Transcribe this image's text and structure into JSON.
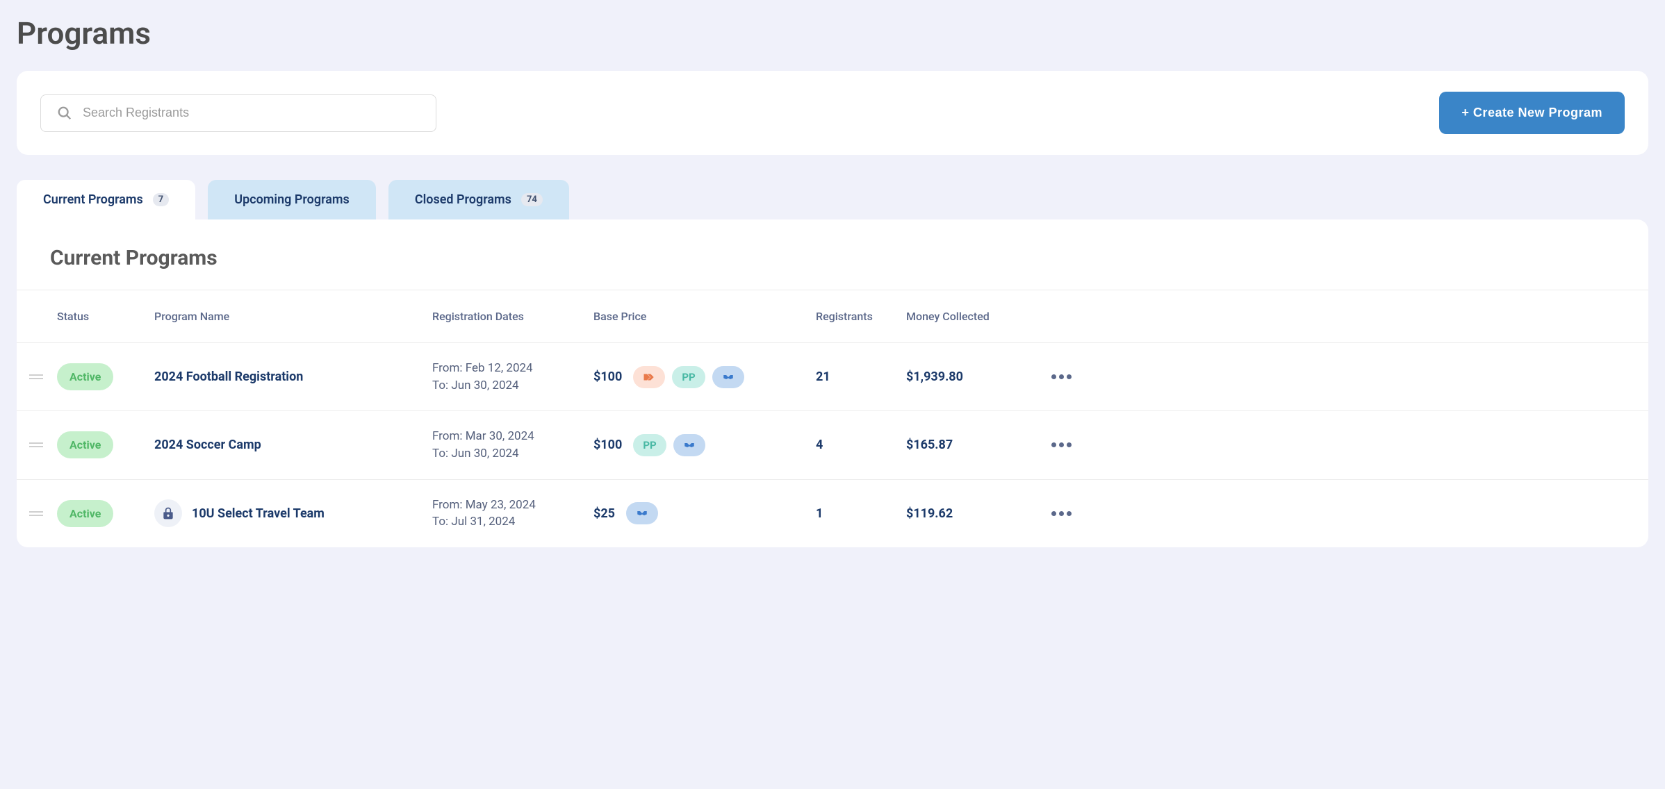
{
  "page": {
    "title": "Programs"
  },
  "toolbar": {
    "search_placeholder": "Search Registrants",
    "create_button_label": "+ Create New Program"
  },
  "tabs": [
    {
      "label": "Current Programs",
      "badge": "7",
      "active": true
    },
    {
      "label": "Upcoming Programs",
      "badge": null,
      "active": false
    },
    {
      "label": "Closed Programs",
      "badge": "74",
      "active": false
    }
  ],
  "section": {
    "title": "Current Programs"
  },
  "table": {
    "headers": {
      "status": "Status",
      "name": "Program Name",
      "dates": "Registration Dates",
      "price": "Base Price",
      "registrants": "Registrants",
      "money": "Money Collected"
    },
    "rows": [
      {
        "status": "Active",
        "locked": false,
        "name": "2024 Football Registration",
        "date_from_label": "From: ",
        "date_from": "Feb 12, 2024",
        "date_to_label": "To: ",
        "date_to": "Jun 30, 2024",
        "price": "$100",
        "pills": {
          "tags": true,
          "pp": true,
          "handshake": true
        },
        "registrants": "21",
        "money": "$1,939.80"
      },
      {
        "status": "Active",
        "locked": false,
        "name": "2024 Soccer Camp",
        "date_from_label": "From: ",
        "date_from": "Mar 30, 2024",
        "date_to_label": "To: ",
        "date_to": "Jun 30, 2024",
        "price": "$100",
        "pills": {
          "tags": false,
          "pp": true,
          "handshake": true
        },
        "registrants": "4",
        "money": "$165.87"
      },
      {
        "status": "Active",
        "locked": true,
        "name": "10U Select Travel Team",
        "date_from_label": "From: ",
        "date_from": "May 23, 2024",
        "date_to_label": "To: ",
        "date_to": "Jul 31, 2024",
        "price": "$25",
        "pills": {
          "tags": false,
          "pp": false,
          "handshake": true
        },
        "registrants": "1",
        "money": "$119.62"
      }
    ]
  },
  "icons": {
    "search": "search-icon",
    "lock": "lock-icon",
    "tags": "tags-icon",
    "payment_plan": "PP",
    "handshake": "handshake-icon",
    "more": "more-icon",
    "drag": "drag-icon"
  }
}
